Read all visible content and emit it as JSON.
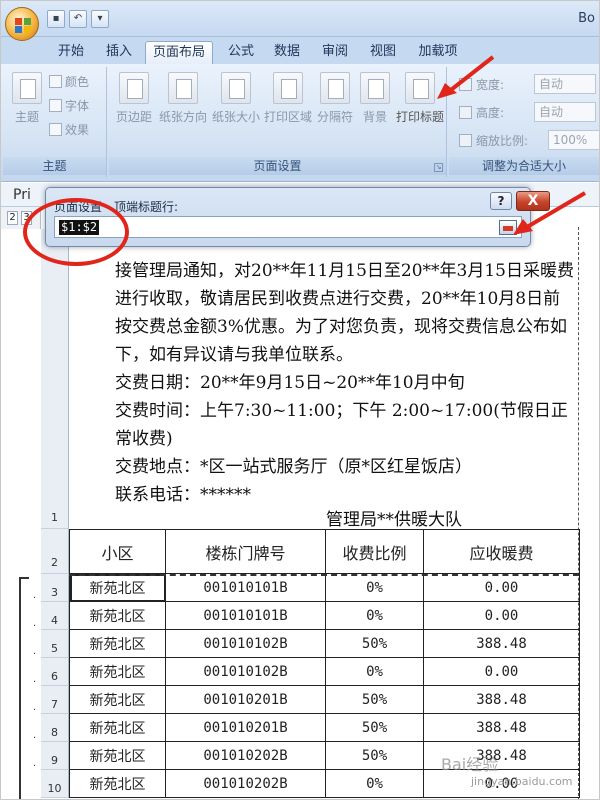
{
  "window": {
    "title_partial": "Bo"
  },
  "tabs": [
    "开始",
    "插入",
    "页面布局",
    "公式",
    "数据",
    "审阅",
    "视图",
    "加载项"
  ],
  "active_tab": "页面布局",
  "ribbon": {
    "theme_group": {
      "label": "主题",
      "main": "主题",
      "colors": "颜色",
      "fonts": "字体",
      "effects": "效果"
    },
    "page_setup_group": {
      "label": "页面设置",
      "buttons": [
        "页边距",
        "纸张方向",
        "纸张大小",
        "打印区域",
        "分隔符",
        "背景",
        "打印标题"
      ]
    },
    "scale_group": {
      "label": "调整为合适大小",
      "width_label": "宽度:",
      "width_value": "自动",
      "height_label": "高度:",
      "height_value": "自动",
      "scale_label": "缩放比例:",
      "scale_value": "100%"
    }
  },
  "name_box": "Pri",
  "outline_levels": [
    "2",
    "3"
  ],
  "dialog": {
    "title": "页面设置 - 顶端标题行:",
    "value": "$1:$2",
    "help": "?",
    "close": "X"
  },
  "notice": {
    "para1": "接管理局通知，对20**年11月15日至20**年3月15日采暖费进行收取，敬请居民到收费点进行交费，20**年10月8日前按交费总金额3%优惠。为了对您负责，现将交费信息公布如下，如有异议请与我单位联系。",
    "line_date": "交费日期：20**年9月15日~20**年10月中旬",
    "line_time": "交费时间：上午7:30~11:00；下午 2:00~17:00(节假日正常收费)",
    "line_place": "交费地点：*区一站式服务厅（原*区红星饭店）",
    "line_phone": "联系电话：******",
    "org": "管理局**供暖大队"
  },
  "table": {
    "headers": [
      "小区",
      "楼栋门牌号",
      "收费比例",
      "应收暖费"
    ],
    "rows": [
      {
        "row": "3",
        "cells": [
          "新苑北区",
          "001010101B",
          "0%",
          "0.00"
        ]
      },
      {
        "row": "4",
        "cells": [
          "新苑北区",
          "001010101B",
          "0%",
          "0.00"
        ]
      },
      {
        "row": "5",
        "cells": [
          "新苑北区",
          "001010102B",
          "50%",
          "388.48"
        ]
      },
      {
        "row": "6",
        "cells": [
          "新苑北区",
          "001010102B",
          "0%",
          "0.00"
        ]
      },
      {
        "row": "7",
        "cells": [
          "新苑北区",
          "001010201B",
          "50%",
          "388.48"
        ]
      },
      {
        "row": "8",
        "cells": [
          "新苑北区",
          "001010201B",
          "50%",
          "388.48"
        ]
      },
      {
        "row": "9",
        "cells": [
          "新苑北区",
          "001010202B",
          "50%",
          "388.48"
        ]
      },
      {
        "row": "10",
        "cells": [
          "新苑北区",
          "001010202B",
          "0%",
          "0.00"
        ]
      }
    ],
    "row_labels_top": [
      "1",
      "2"
    ]
  },
  "watermark": {
    "text": "Bai经验",
    "sub": "jingyan.baidu.com"
  },
  "colors": {
    "annotation_red": "#e0261b",
    "ribbon_blue": "#c5d9f1"
  }
}
